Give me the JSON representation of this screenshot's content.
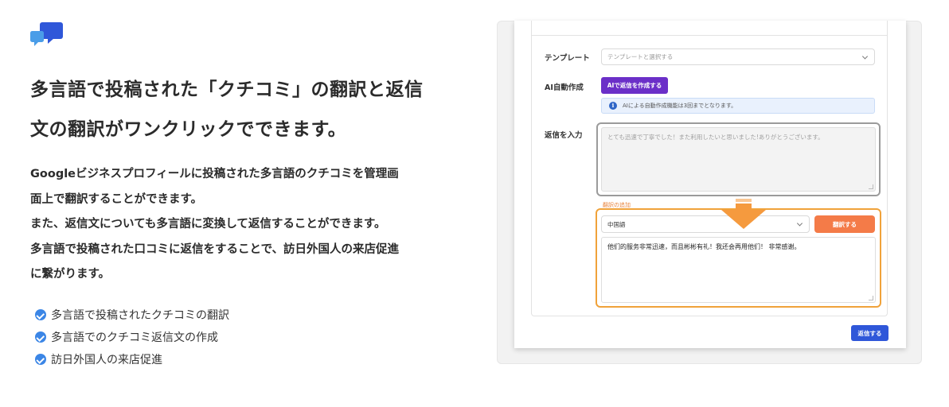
{
  "headline": {
    "line1": "多言語で投稿された「クチコミ」の翻訳と返信",
    "line2": "文の翻訳がワンクリックでできます。"
  },
  "description": {
    "line1": "Googleビジネスプロフィールに投稿された多言語のクチコミを管理画",
    "line2": "面上で翻訳することができます。",
    "line3": "また、返信文についても多言語に変換して返信することができます。",
    "line4": "多言語で投稿された口コミに返信をすることで、訪日外国人の来店促進",
    "line5": "に繋がります。"
  },
  "features": [
    "多言語で投稿されたクチコミの翻訳",
    "多言語でのクチコミ返信文の作成",
    "訪日外国人の来店促進"
  ],
  "form": {
    "template_label": "テンプレート",
    "template_placeholder": "テンプレートと選択する",
    "ai_label": "AI自動作成",
    "ai_button": "AIで返信を作成する",
    "ai_info": "AIによる自動作成機能は3回までとなります。",
    "reply_label": "返信を入力",
    "reply_text": "とても迅速で丁寧でした！また利用したいと思いました!ありがとうございます。",
    "add_translation": "翻訳の追加",
    "language_selected": "中国語",
    "translate_button": "翻訳する",
    "translated_text": "他们的服务非常迅速，而且彬彬有礼！我还会再用他们！ 非常感谢。",
    "send_button": "返信する"
  },
  "colors": {
    "accent_blue": "#3b86e6",
    "ai_purple": "#6b2fc8",
    "translate_orange": "#f47b48",
    "highlight_orange": "#f0a23a",
    "send_blue": "#2f57d9"
  }
}
